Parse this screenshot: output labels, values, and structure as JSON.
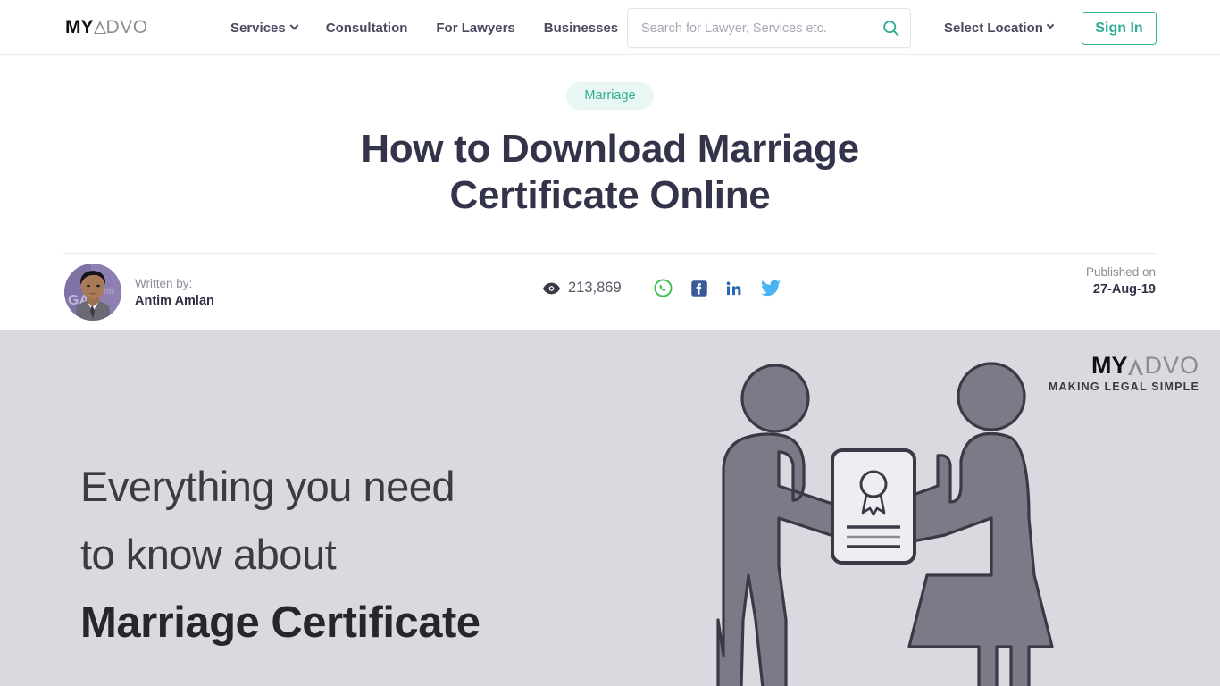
{
  "header": {
    "logo": {
      "bold": "MY",
      "light": "DVO",
      "icon": "triangle-a-icon"
    },
    "nav": [
      {
        "label": "Services",
        "has_dropdown": true
      },
      {
        "label": "Consultation",
        "has_dropdown": false
      },
      {
        "label": "For Lawyers",
        "has_dropdown": false
      },
      {
        "label": "Businesses",
        "has_dropdown": false
      }
    ],
    "search": {
      "placeholder": "Search for Lawyer, Services etc.",
      "value": "",
      "icon": "search-icon"
    },
    "location": {
      "label": "Select Location",
      "icon": "chevron-down-icon"
    },
    "signin": {
      "label": "Sign In"
    }
  },
  "article": {
    "category": "Marriage",
    "title": "How to Download Marriage Certificate Online",
    "author": {
      "written_by_label": "Written by:",
      "name": "Antim Amlan"
    },
    "views": {
      "count": "213,869",
      "icon": "eye-icon"
    },
    "share": [
      {
        "name": "whatsapp-icon",
        "color": "#3dc14f"
      },
      {
        "name": "facebook-icon",
        "color": "#3b5998"
      },
      {
        "name": "linkedin-icon",
        "color": "#2867b2"
      },
      {
        "name": "twitter-icon",
        "color": "#4ab3f4"
      }
    ],
    "published": {
      "label": "Published on",
      "date": "27-Aug-19"
    }
  },
  "banner": {
    "line1": "Everything you need",
    "line2": "to know about",
    "line3": "Marriage Certificate",
    "watermark": {
      "bold": "MY",
      "light": "DVO",
      "tagline": "MAKING LEGAL SIMPLE"
    },
    "illustration": "two-people-exchanging-certificate-illustration",
    "background_color": "#d9d9df"
  },
  "colors": {
    "accent": "#2fae94",
    "title": "#33344a",
    "nav_text": "#4a4a60",
    "badge_bg": "#e9f7f4"
  }
}
